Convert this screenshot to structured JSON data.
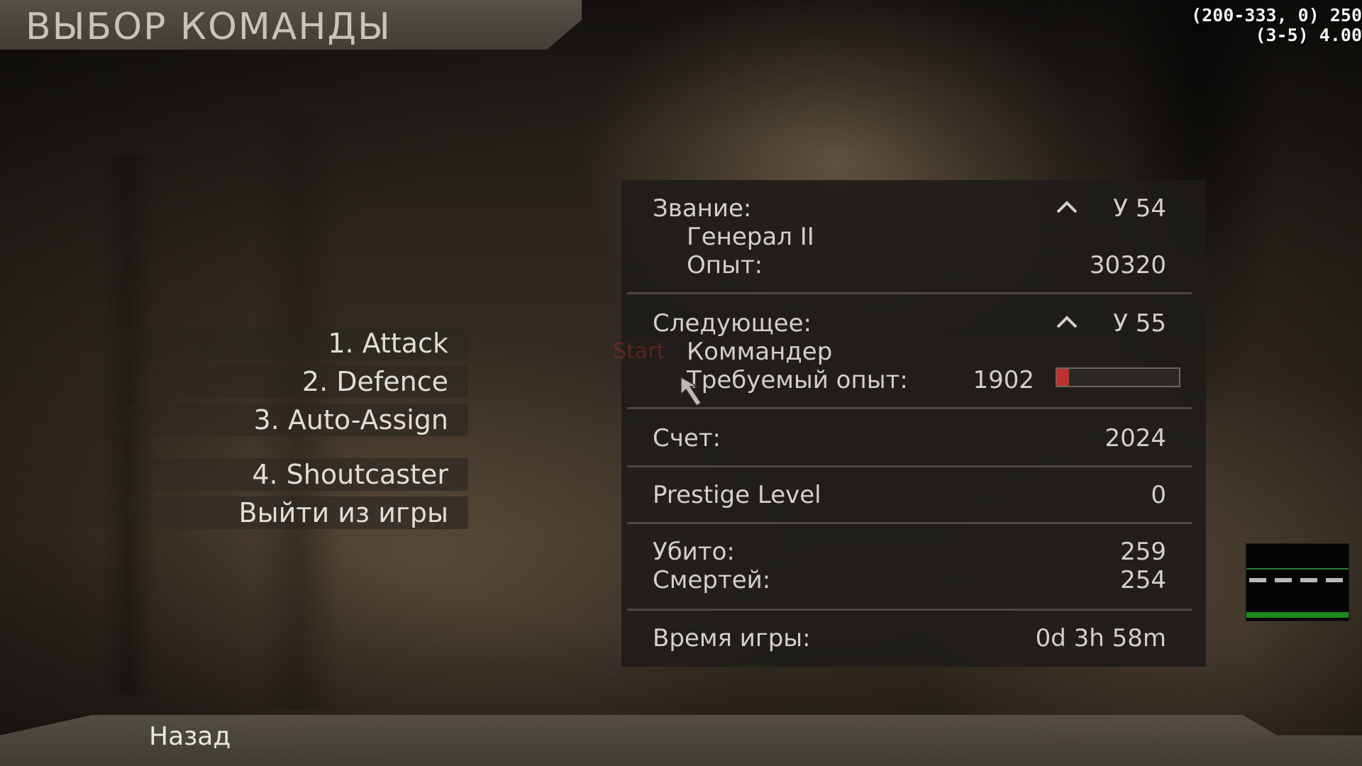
{
  "header": {
    "title": "ВЫБОР КОМАНДЫ"
  },
  "debug": {
    "line1": "(200-333, 0) 250",
    "line2": "(3-5) 4.00"
  },
  "menu": {
    "items": [
      {
        "label": "1. Attack"
      },
      {
        "label": "2. Defence"
      },
      {
        "label": "3. Auto-Assign"
      },
      {
        "label": "4. Shoutcaster"
      },
      {
        "label": "Выйти из игры"
      }
    ]
  },
  "stats": {
    "rank": {
      "label": "Звание:",
      "level": "У 54",
      "name": "Генерал II",
      "xp_label": "Опыт:",
      "xp": "30320"
    },
    "next": {
      "label": "Следующее:",
      "level": "У 55",
      "name": "Коммандер",
      "required_label": "Требуемый опыт:",
      "required": "1902",
      "progress_fraction": 0.1
    },
    "score": {
      "label": "Счет:",
      "value": "2024"
    },
    "prestige": {
      "label": "Prestige Level",
      "value": "0"
    },
    "kills": {
      "label": "Убито:",
      "value": "259"
    },
    "deaths": {
      "label": "Смертей:",
      "value": "254"
    },
    "playtime": {
      "label": "Время игры:",
      "value": "0d 3h 58m"
    }
  },
  "ghost_text": "Start",
  "footer": {
    "back_label": "Назад"
  },
  "colors": {
    "progress_fill": "#c03030",
    "minimap_ground": "#1c8a1c"
  }
}
